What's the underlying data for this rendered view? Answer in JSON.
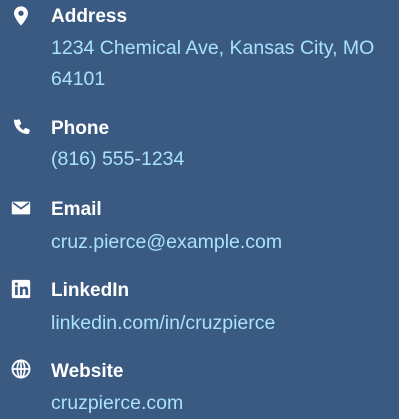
{
  "contact": {
    "address": {
      "label": "Address",
      "value": "1234 Chemical Ave, Kansas City, MO 64101",
      "icon": "map-marker-icon"
    },
    "phone": {
      "label": "Phone",
      "value": "(816) 555-1234",
      "icon": "phone-icon"
    },
    "email": {
      "label": "Email",
      "value": "cruz.pierce@example.com",
      "icon": "envelope-icon"
    },
    "linkedin": {
      "label": "LinkedIn",
      "value": "linkedin.com/in/cruzpierce",
      "icon": "linkedin-icon"
    },
    "website": {
      "label": "Website",
      "value": "cruzpierce.com",
      "icon": "globe-icon"
    }
  },
  "colors": {
    "background": "#3a5a82",
    "label": "#ffffff",
    "value": "#a9e1ff"
  }
}
